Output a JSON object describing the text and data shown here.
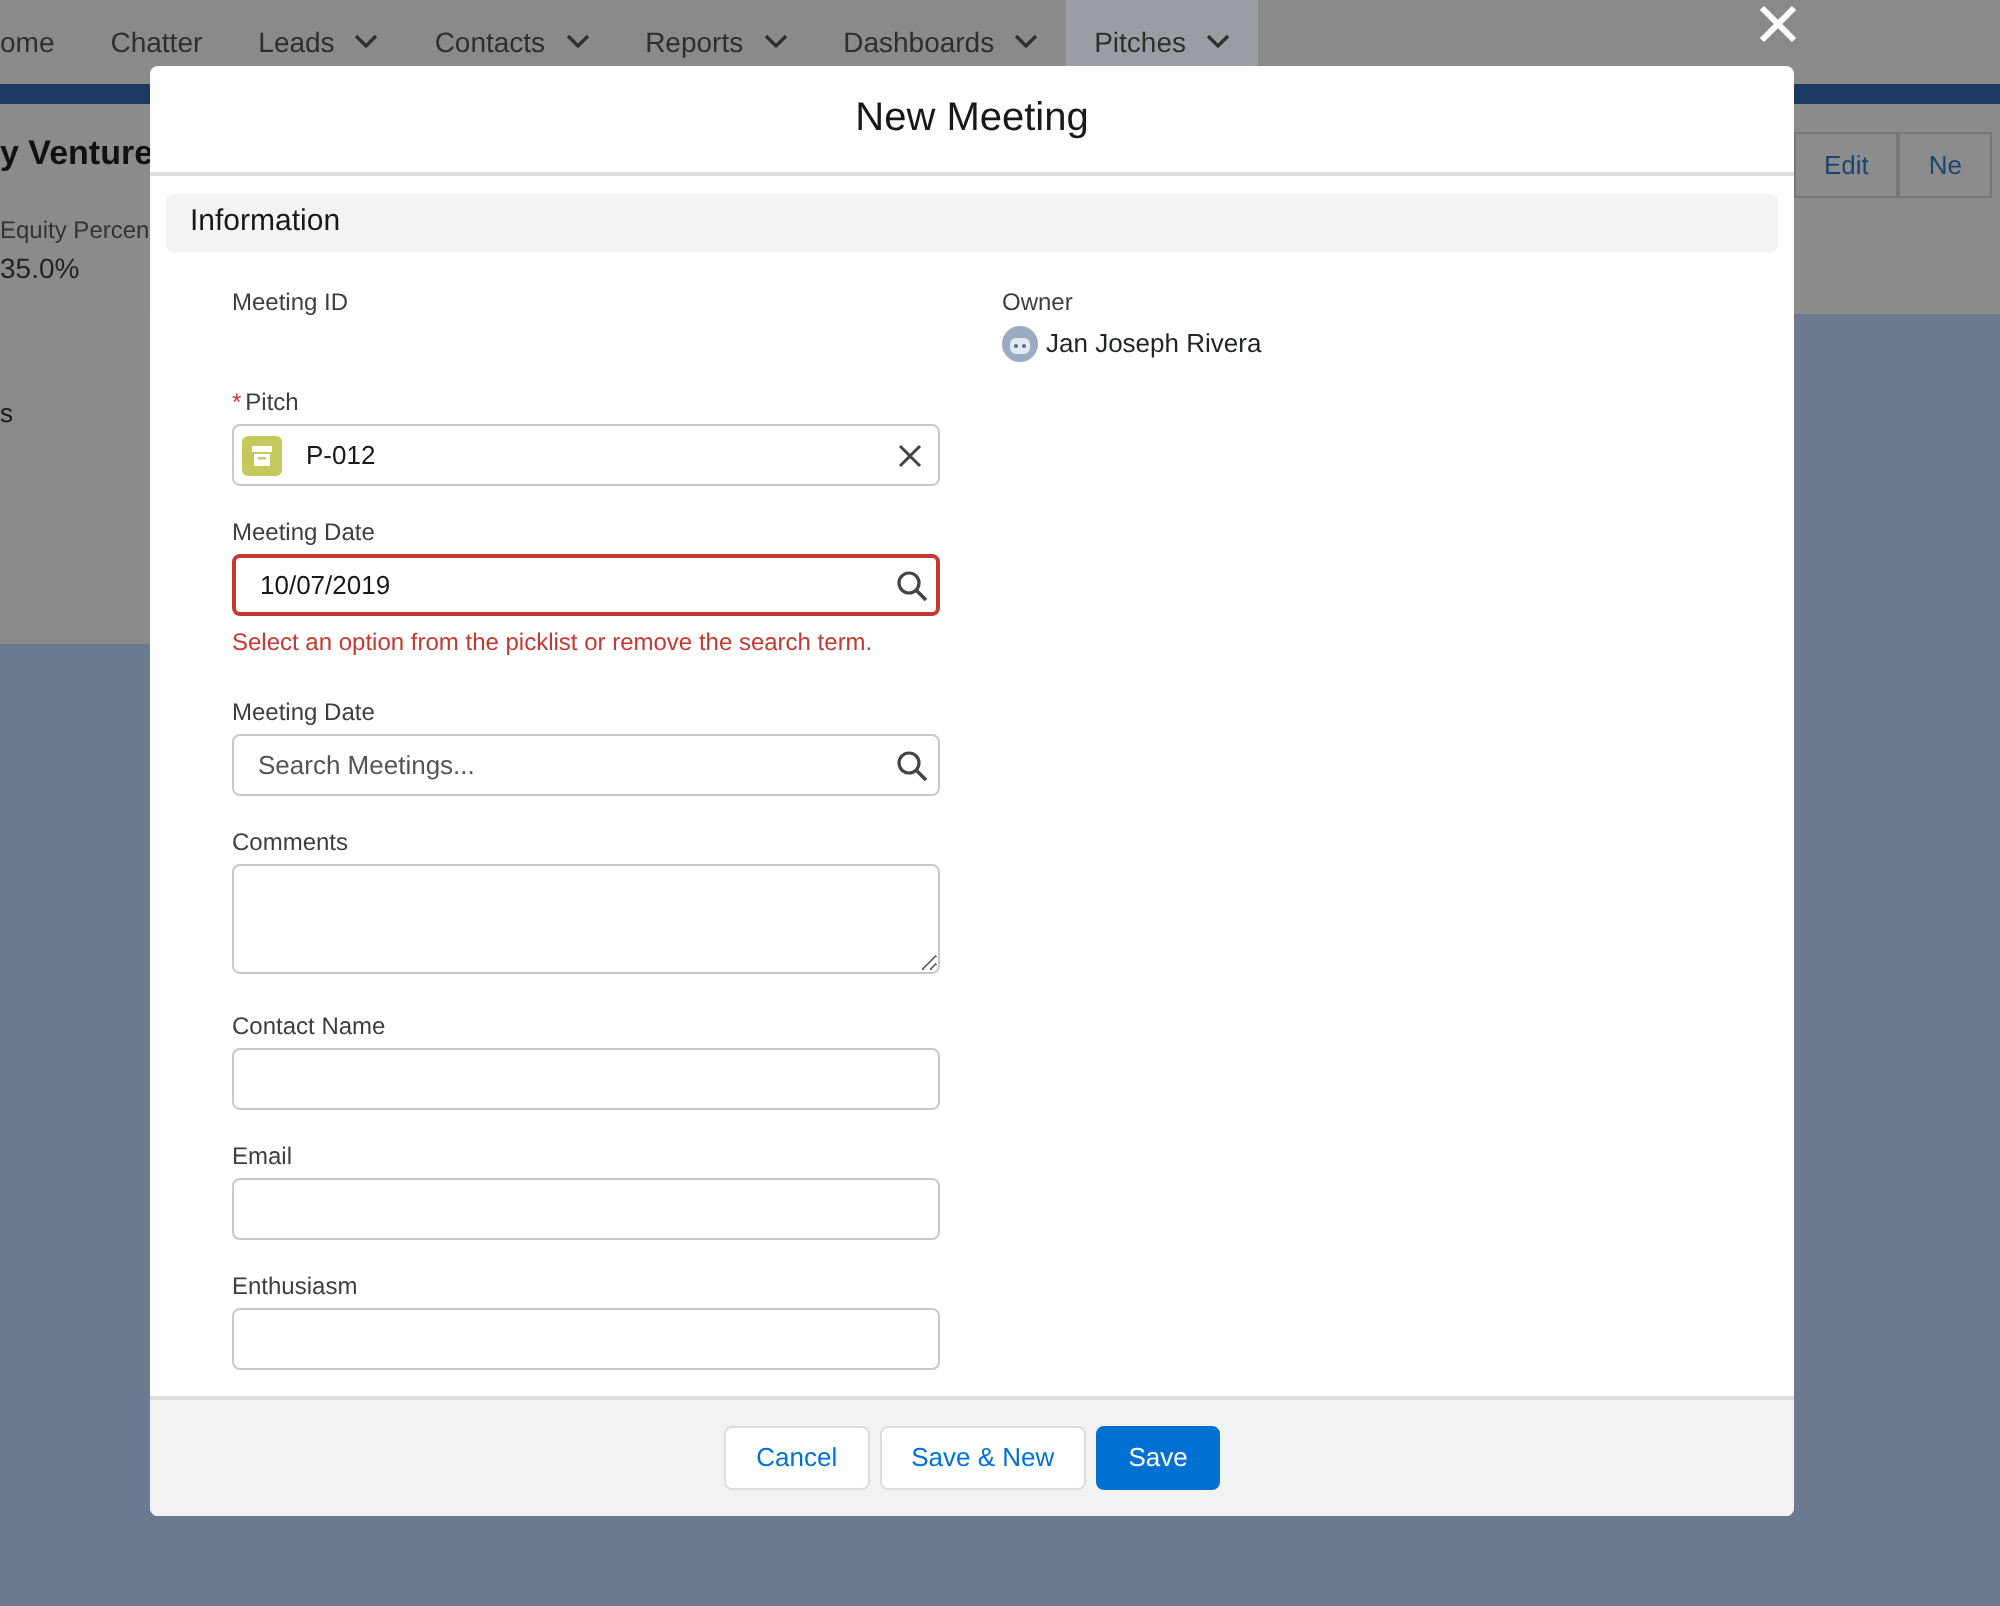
{
  "background": {
    "nav": [
      {
        "label": "ome",
        "selected": false,
        "menu": false
      },
      {
        "label": "Chatter",
        "selected": false,
        "menu": false
      },
      {
        "label": "Leads",
        "selected": false,
        "menu": true
      },
      {
        "label": "Contacts",
        "selected": false,
        "menu": true
      },
      {
        "label": "Reports",
        "selected": false,
        "menu": true
      },
      {
        "label": "Dashboards",
        "selected": false,
        "menu": true
      },
      {
        "label": "Pitches",
        "selected": true,
        "menu": true
      }
    ],
    "record_title": "y Venture",
    "highlights": [
      {
        "label": "Equity Percen",
        "value": "35.0%"
      }
    ],
    "actions": [
      "Edit",
      "Ne"
    ],
    "tab": "s"
  },
  "modal": {
    "title": "New Meeting",
    "section": "Information",
    "left_fields": [
      {
        "kind": "readonly",
        "label": "Meeting ID"
      },
      {
        "kind": "lookup",
        "label": "Pitch",
        "required_mark": "*",
        "value": "P-012"
      },
      {
        "kind": "search",
        "label": "Meeting Date",
        "value": "10/07/2019",
        "error": "Select an option from the picklist or remove the search term."
      },
      {
        "kind": "search",
        "label": "Meeting Date",
        "placeholder": "Search Meetings..."
      },
      {
        "kind": "textarea",
        "label": "Comments"
      },
      {
        "kind": "text",
        "label": "Contact Name"
      },
      {
        "kind": "text",
        "label": "Email"
      },
      {
        "kind": "text",
        "label": "Enthusiasm"
      }
    ],
    "right_fields": [
      {
        "kind": "owner",
        "label": "Owner",
        "value": "Jan Joseph Rivera"
      }
    ],
    "buttons": [
      {
        "label": "Cancel",
        "kind": "neutral"
      },
      {
        "label": "Save & New",
        "kind": "neutral"
      },
      {
        "label": "Save",
        "kind": "brand"
      }
    ]
  }
}
